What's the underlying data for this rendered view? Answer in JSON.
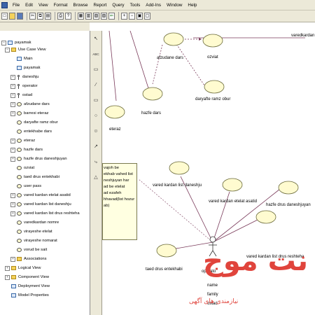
{
  "menubar": {
    "items": [
      "File",
      "Edit",
      "View",
      "Format",
      "Browse",
      "Report",
      "Query",
      "Tools",
      "Add-Ins",
      "Window",
      "Help"
    ]
  },
  "toolbar": {
    "icons": [
      "new-icon",
      "open-icon",
      "save-icon",
      "cut-icon",
      "copy-icon",
      "paste-icon",
      "print-icon",
      "help-icon",
      "browse-class-icon",
      "browse-interaction-icon",
      "browse-component-icon",
      "browse-deployment-icon",
      "browse-previous-icon",
      "zoom-in-icon",
      "zoom-out-icon",
      "fit-icon",
      "undo-fit-icon"
    ]
  },
  "browser": {
    "root": "payamak",
    "items": [
      {
        "label": "Use Case View",
        "icon": "folder",
        "level": 1,
        "exp": "-"
      },
      {
        "label": "Main",
        "icon": "diagram",
        "level": 2,
        "exp": ""
      },
      {
        "label": "payamak",
        "icon": "diagram",
        "level": 2,
        "exp": ""
      },
      {
        "label": "daneshju",
        "icon": "actor",
        "level": 2,
        "exp": "+"
      },
      {
        "label": "operator",
        "icon": "actor",
        "level": 2,
        "exp": "+"
      },
      {
        "label": "ostad",
        "icon": "actor",
        "level": 2,
        "exp": "+"
      },
      {
        "label": "afzudane dars",
        "icon": "usecase",
        "level": 2,
        "exp": "+"
      },
      {
        "label": "barresi eteraz",
        "icon": "usecase",
        "level": 2,
        "exp": "+"
      },
      {
        "label": "daryafte ramz obur",
        "icon": "usecase",
        "level": 2,
        "exp": ""
      },
      {
        "label": "entekhabe dars",
        "icon": "usecase",
        "level": 2,
        "exp": ""
      },
      {
        "label": "eteraz",
        "icon": "usecase",
        "level": 2,
        "exp": "+"
      },
      {
        "label": "hazfe dars",
        "icon": "usecase",
        "level": 2,
        "exp": "+"
      },
      {
        "label": "hazfe drus daneshjuyan",
        "icon": "usecase",
        "level": 2,
        "exp": "+"
      },
      {
        "label": "ozviat",
        "icon": "usecase",
        "level": 2,
        "exp": ""
      },
      {
        "label": "taed drus entekhabi",
        "icon": "usecase",
        "level": 2,
        "exp": ""
      },
      {
        "label": "user pass",
        "icon": "usecase",
        "level": 2,
        "exp": ""
      },
      {
        "label": "vared kardan etelat asatid",
        "icon": "usecase",
        "level": 2,
        "exp": "+"
      },
      {
        "label": "vared kardan list daneshju",
        "icon": "usecase",
        "level": 2,
        "exp": "+"
      },
      {
        "label": "vared kardan list drus reshteha",
        "icon": "usecase",
        "level": 2,
        "exp": "+"
      },
      {
        "label": "varedkardan nomre",
        "icon": "usecase",
        "level": 2,
        "exp": ""
      },
      {
        "label": "virayeshe etelat",
        "icon": "usecase",
        "level": 2,
        "exp": ""
      },
      {
        "label": "virayeshe nomarat",
        "icon": "usecase",
        "level": 2,
        "exp": ""
      },
      {
        "label": "vorud be sait",
        "icon": "usecase",
        "level": 2,
        "exp": ""
      },
      {
        "label": "Associations",
        "icon": "folder",
        "level": 2,
        "exp": "+"
      },
      {
        "label": "Logical View",
        "icon": "folder",
        "level": 1,
        "exp": "+"
      },
      {
        "label": "Component View",
        "icon": "folder",
        "level": 1,
        "exp": "+"
      },
      {
        "label": "Deployment View",
        "icon": "diagram",
        "level": 1,
        "exp": ""
      },
      {
        "label": "Model Properties",
        "icon": "diagram",
        "level": 1,
        "exp": ""
      }
    ]
  },
  "palette": {
    "tools": [
      "select-arrow-icon",
      "text-tool-icon",
      "note-tool-icon",
      "anchor-tool-icon",
      "package-tool-icon",
      "usecase-tool-icon",
      "actor-tool-icon",
      "unidirectional-assoc-icon",
      "dependency-tool-icon",
      "generalization-tool-icon"
    ],
    "glyphs": [
      "↖",
      "ABC",
      "▭",
      "⁄",
      "▭",
      "○",
      "☺",
      "↗",
      "⤷",
      "△"
    ]
  },
  "diagram": {
    "usecases": [
      {
        "label": "afzudane dars"
      },
      {
        "label": "ozviat"
      },
      {
        "label": "daryafte ramz obur"
      },
      {
        "label": "hazfe dars"
      },
      {
        "label": "eteraz"
      },
      {
        "label": "vared kardan list daneshju"
      },
      {
        "label": "vared kardan etelat asatid"
      },
      {
        "label": "hazfe drus daneshjuyan"
      },
      {
        "label": "vared kardan list drus reshteha"
      },
      {
        "label": "taed drus entekhabi"
      }
    ],
    "corner_label": "varedkardan",
    "actor_label": "operato",
    "note_lines": [
      "vajoh be",
      "ekhab vahed list",
      "neshjuyan har",
      "ad be etelat",
      "ad ezafeh",
      "hhavad(list hozur",
      "ab)"
    ],
    "tooltip_fragments": [
      "name",
      "family",
      "ostad"
    ]
  },
  "watermark": {
    "main": "نت موج",
    "sub": "نیازمندی های آگهی"
  }
}
